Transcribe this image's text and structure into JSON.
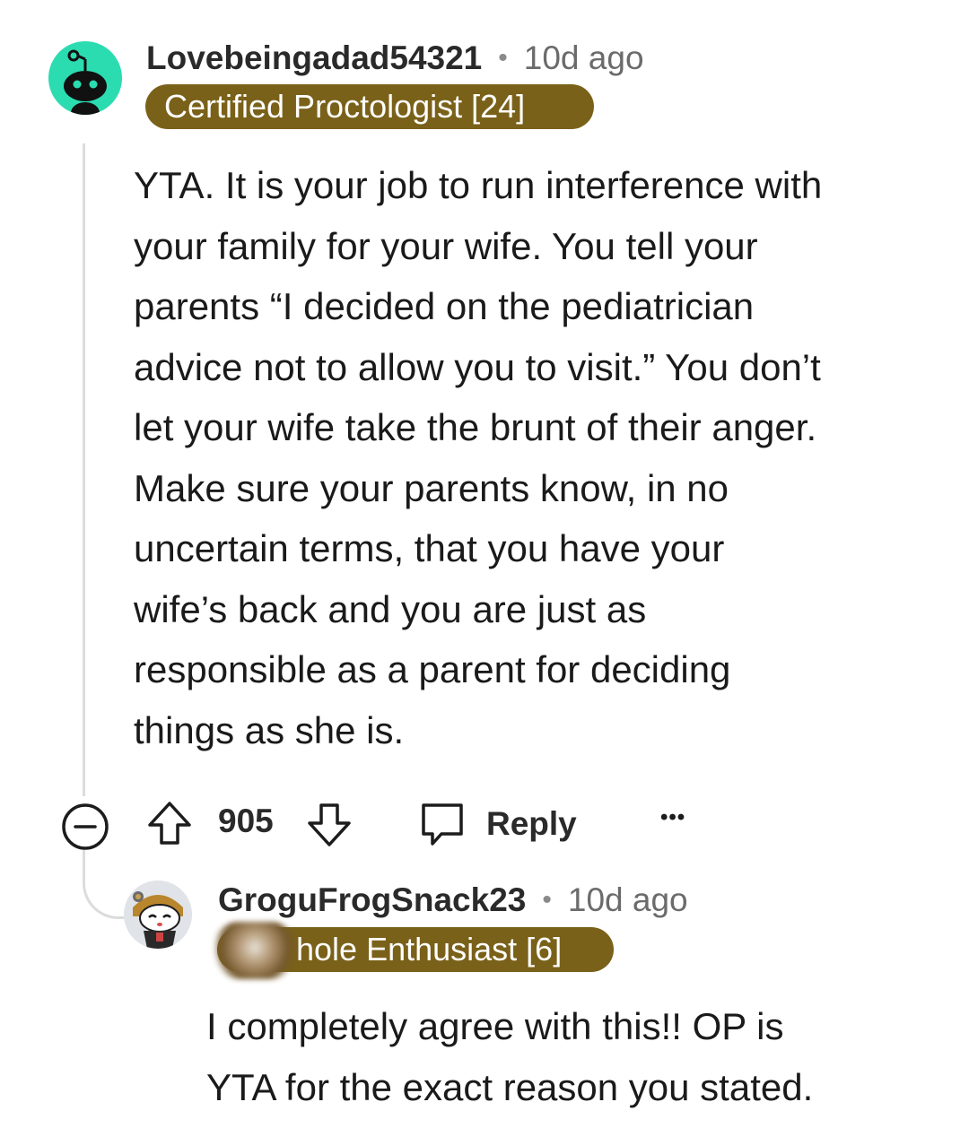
{
  "colors": {
    "avatar1_bg": "#2bdcb1",
    "flair_bg": "#7a6119",
    "flair_text": "#ffffff",
    "thread_line": "#dcdcdc"
  },
  "comment": {
    "username": "Lovebeingadad54321",
    "separator": "•",
    "time": "10d ago",
    "flair": "Certified Proctologist [24]",
    "body": "YTA. It is your job to run interference with\nyour family for your wife. You tell your\nparents “I decided on the pediatrician\nadvice not to allow you to visit.” You don’t\nlet your wife take the brunt of their anger.\nMake sure your parents know, in no\nuncertain terms, that you have your\nwife’s back and you are just as\nresponsible as a parent for deciding\nthings as she is.",
    "votes": "905",
    "reply_label": "Reply",
    "more_label": "•••"
  },
  "reply": {
    "username": "GroguFrogSnack23",
    "separator": "•",
    "time": "10d ago",
    "flair": "hole Enthusiast [6]",
    "body": "I completely agree with this!! OP is\nYTA for the exact reason you stated."
  },
  "icons": {
    "collapse": "minus-circle-icon",
    "upvote": "arrow-up-icon",
    "downvote": "arrow-down-icon",
    "reply": "speech-bubble-icon",
    "more": "ellipsis-icon"
  }
}
